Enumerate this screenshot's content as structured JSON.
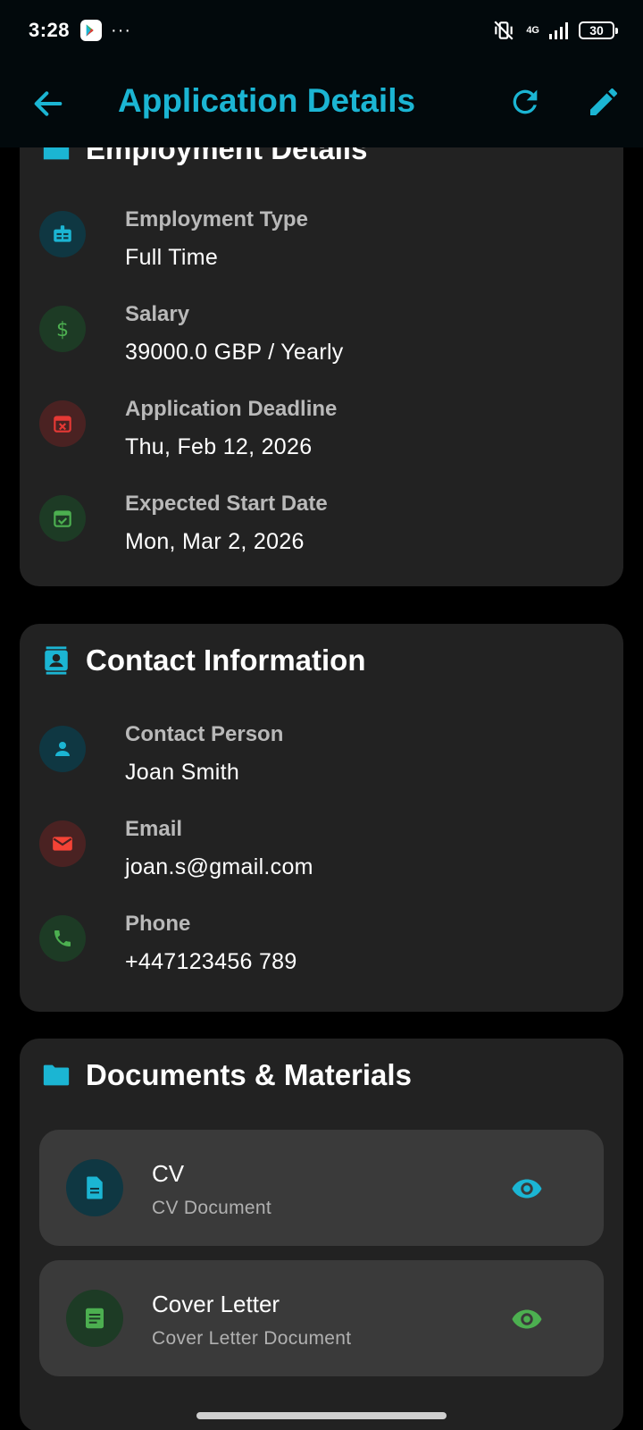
{
  "status_bar": {
    "time": "3:28",
    "more": "···",
    "network": "4G",
    "battery": "30"
  },
  "app_bar": {
    "title": "Application Details"
  },
  "employment": {
    "header": "Employment Details",
    "rows": [
      {
        "label": "Employment Type",
        "value": "Full Time",
        "icon": "badge-icon",
        "color": "#1bb5d3"
      },
      {
        "label": "Salary",
        "value": "39000.0 GBP / Yearly",
        "icon": "dollar-icon",
        "color": "#4caf50"
      },
      {
        "label": "Application Deadline",
        "value": "Thu, Feb 12, 2026",
        "icon": "calendar-x-icon",
        "color": "#e53935"
      },
      {
        "label": "Expected Start Date",
        "value": "Mon, Mar 2, 2026",
        "icon": "calendar-check-icon",
        "color": "#4caf50"
      }
    ]
  },
  "contact": {
    "header": "Contact Information",
    "rows": [
      {
        "label": "Contact Person",
        "value": "Joan Smith",
        "icon": "person-icon",
        "color": "#1bb5d3"
      },
      {
        "label": "Email",
        "value": "joan.s@gmail.com",
        "icon": "mail-icon",
        "color": "#f44336"
      },
      {
        "label": "Phone",
        "value": "+447123456 789",
        "icon": "phone-icon",
        "color": "#4caf50"
      }
    ]
  },
  "documents": {
    "header": "Documents & Materials",
    "items": [
      {
        "title": "CV",
        "subtitle": "CV Document",
        "icon": "document-icon",
        "color": "#1bb5d3"
      },
      {
        "title": "Cover Letter",
        "subtitle": "Cover Letter Document",
        "icon": "letter-icon",
        "color": "#4caf50"
      }
    ]
  },
  "colors": {
    "accent": "#1bb5d3",
    "card": "#222222",
    "background": "#000000"
  }
}
